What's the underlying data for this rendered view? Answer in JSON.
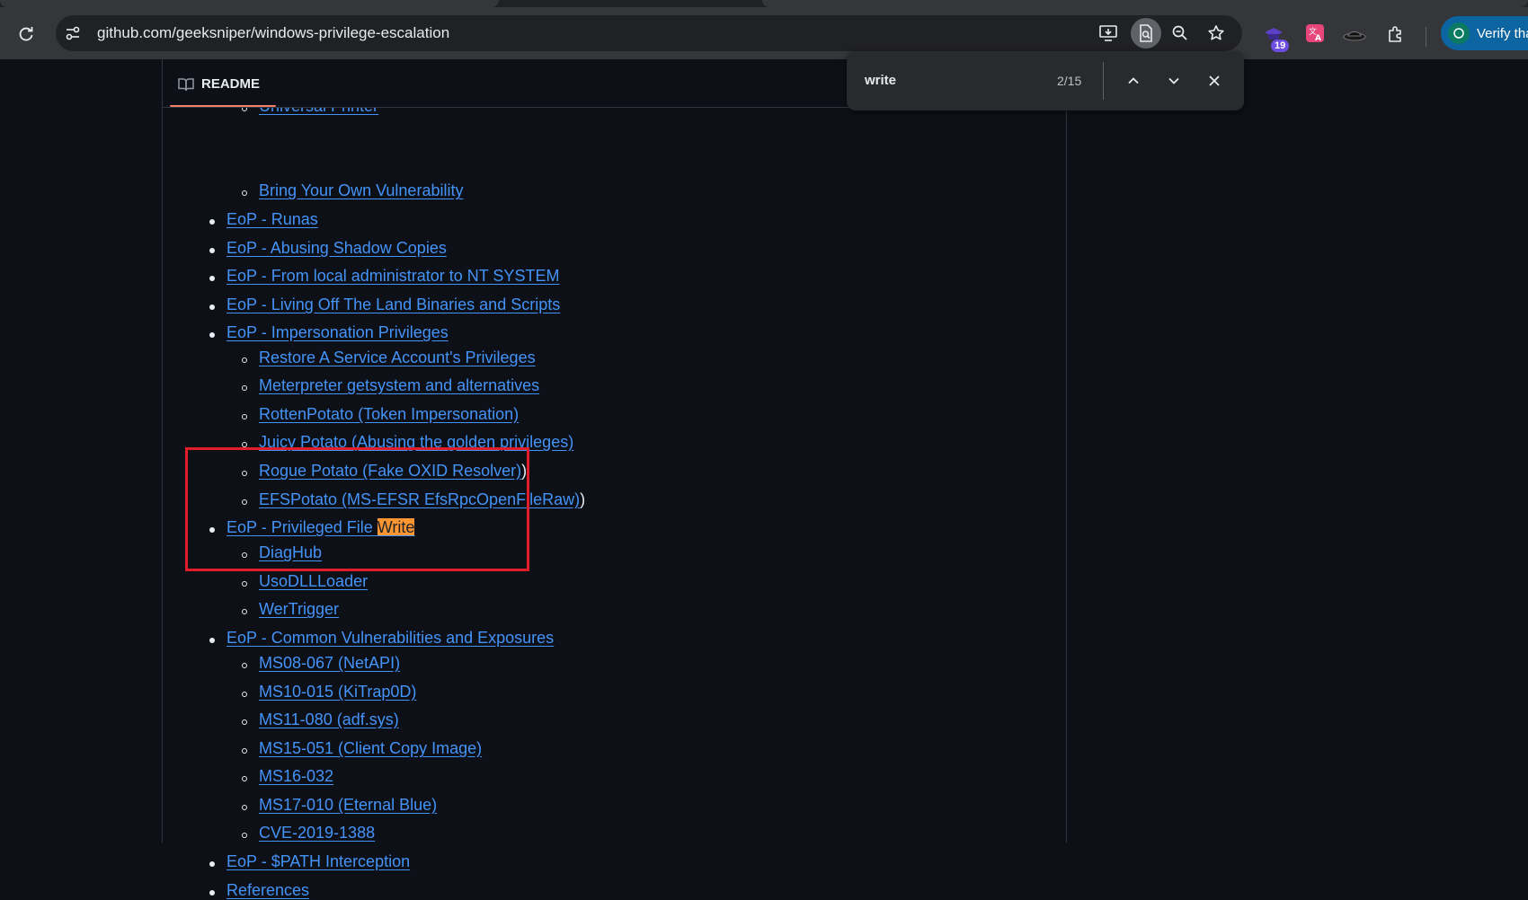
{
  "browser": {
    "url": "github.com/geeksniper/windows-privilege-escalation",
    "extension_badge": "19",
    "verify_label": "Verify tha"
  },
  "find": {
    "query": "write",
    "count": "2/15"
  },
  "readme": {
    "tab_label": "README"
  },
  "list": [
    {
      "text": "Universal Printer",
      "level": 2
    },
    {
      "text": "Bring Your Own Vulnerability",
      "level": 2
    },
    {
      "text": "EoP - Runas",
      "level": 1
    },
    {
      "text": "EoP - Abusing Shadow Copies",
      "level": 1
    },
    {
      "text": "EoP - From local administrator to NT SYSTEM",
      "level": 1
    },
    {
      "text": "EoP - Living Off The Land Binaries and Scripts",
      "level": 1
    },
    {
      "text": "EoP - Impersonation Privileges",
      "level": 1
    },
    {
      "text": "Restore A Service Account's Privileges",
      "level": 2
    },
    {
      "text": "Meterpreter getsystem and alternatives",
      "level": 2
    },
    {
      "text": "RottenPotato (Token Impersonation)",
      "level": 2
    },
    {
      "text": "Juicy Potato (Abusing the golden privileges)",
      "level": 2
    },
    {
      "text": "Rogue Potato (Fake OXID Resolver)",
      "level": 2,
      "suffix": ")"
    },
    {
      "text": "EFSPotato (MS-EFSR EfsRpcOpenFileRaw)",
      "level": 2,
      "suffix": ")"
    },
    {
      "text": "EoP - Privileged File ",
      "highlight": "Write",
      "level": 1
    },
    {
      "text": "DiagHub",
      "level": 2
    },
    {
      "text": "UsoDLLLoader",
      "level": 2
    },
    {
      "text": "WerTrigger",
      "level": 2
    },
    {
      "text": "EoP - Common Vulnerabilities and Exposures",
      "level": 1
    },
    {
      "text": "MS08-067 (NetAPI)",
      "level": 2
    },
    {
      "text": "MS10-015 (KiTrap0D)",
      "level": 2
    },
    {
      "text": "MS11-080 (adf.sys)",
      "level": 2
    },
    {
      "text": "MS15-051 (Client Copy Image)",
      "level": 2
    },
    {
      "text": "MS16-032",
      "level": 2
    },
    {
      "text": "MS17-010 (Eternal Blue)",
      "level": 2
    },
    {
      "text": "CVE-2019-1388",
      "level": 2
    },
    {
      "text": "EoP - $PATH Interception",
      "level": 1
    },
    {
      "text": "References",
      "level": 1
    }
  ],
  "icons": [
    "reload-icon",
    "site-settings-icon",
    "install-app-icon",
    "find-in-page-icon",
    "zoom-icon",
    "bookmark-star-icon",
    "extension-icon",
    "translate-icon",
    "hat-icon",
    "puzzle-icon",
    "book-icon",
    "chevron-up-icon",
    "chevron-down-icon",
    "close-icon"
  ],
  "colors": {
    "link": "#4493f8",
    "find_highlight": "#ff9632",
    "annotation_box": "#e11d2a",
    "accent_underline": "#f78166"
  }
}
